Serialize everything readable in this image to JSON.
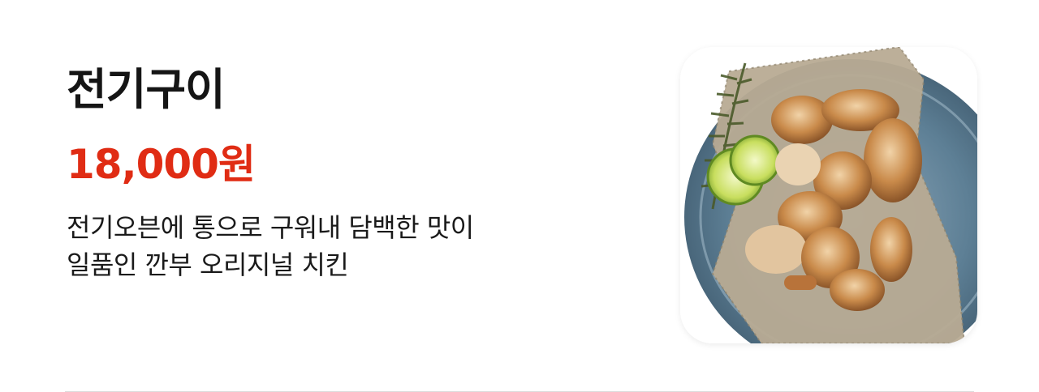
{
  "product": {
    "name": "전기구이",
    "price": "18,000원",
    "description_lines": [
      "전기오븐에 통으로 구워내 담백한 맛이",
      "일품인 깐부 오리지널 치킨"
    ]
  },
  "colors": {
    "price": "#e02c14",
    "title": "#151515",
    "plate": "#5d7f95"
  },
  "image_subject": "roast-chicken-plate"
}
